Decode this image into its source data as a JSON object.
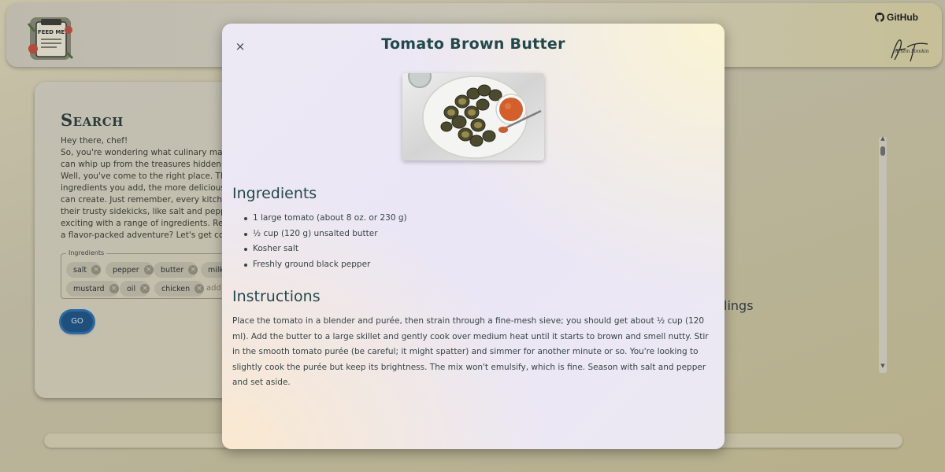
{
  "header": {
    "logo_text": "FEED ME",
    "github_label": "GitHub",
    "signature_text": "Artem Fomkin"
  },
  "search": {
    "title": "Search",
    "intro": "Hey there, chef!\nSo, you're wondering what culinary masterpieces you can whip up from the treasures hidden in your fridge? Well, you've come to the right place. The more ingredients you add, the more delicious concoctions we can create. Just remember, every kitchen wizard needs their trusty sidekicks, like salt and pepper! Let's keep it exciting with a range of ingredients. Ready to embark on a flavor-packed adventure? Let's get cooking!",
    "ingredients_legend": "Ingredients",
    "chips": [
      "salt",
      "pepper",
      "butter",
      "milk",
      "mustard",
      "oil",
      "chicken"
    ],
    "add_placeholder": "add",
    "go_label": "GO"
  },
  "results": {
    "heading_fragment": "lings"
  },
  "modal": {
    "close_label": "×",
    "title": "Tomato Brown Butter",
    "ingredients_heading": "Ingredients",
    "ingredients": [
      "1 large tomato (about 8 oz. or 230 g)",
      "½ cup (120 g) unsalted butter",
      "Kosher salt",
      "Freshly ground black pepper"
    ],
    "instructions_heading": "Instructions",
    "instructions": "Place the tomato in a blender and purée, then strain through a fine-mesh sieve; you should get about ½ cup (120 ml). Add the butter to a large skillet and gently cook over medium heat until it starts to brown and smell nutty. Stir in the smooth tomato purée (be careful; it might spatter) and simmer for another minute or so. You're looking to slightly cook the purée but keep its brightness. The mix won't emulsify, which is fine. Season with salt and pepper and set aside."
  },
  "colors": {
    "accent": "#23484a",
    "go_button": "#1f4f7c"
  }
}
